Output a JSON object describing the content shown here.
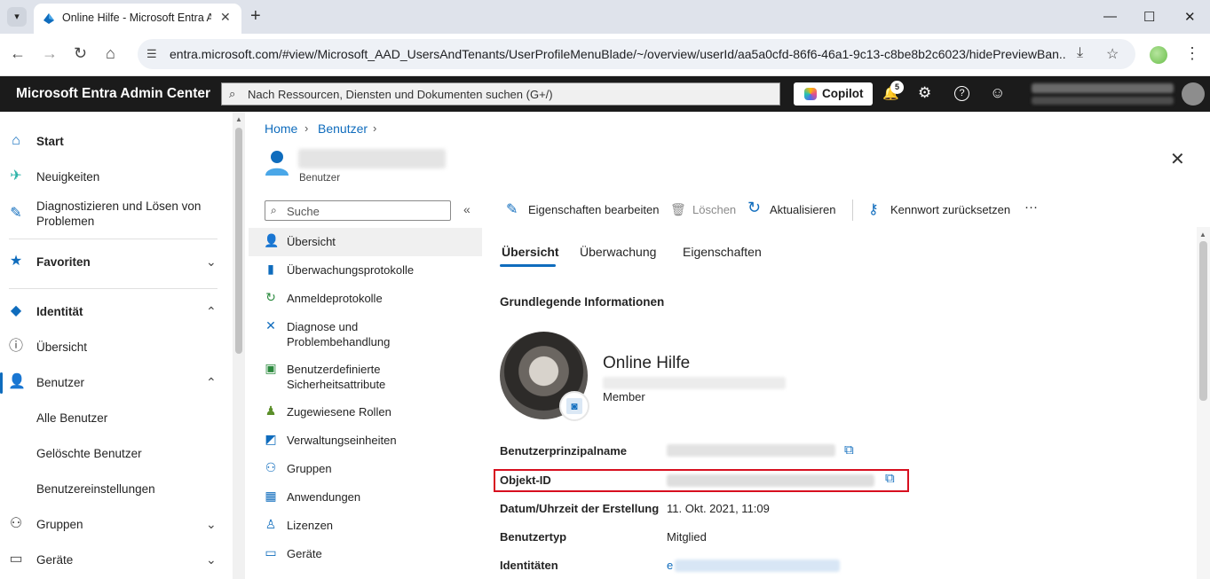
{
  "browser": {
    "tab_title": "Online Hilfe - Microsoft Entra A",
    "url": "entra.microsoft.com/#view/Microsoft_AAD_UsersAndTenants/UserProfileMenuBlade/~/overview/userId/aa5a0cfd-86f6-46a1-9c13-c8be8b2c6023/hidePreviewBan...",
    "icons": {
      "dropdown": "▾",
      "close": "✕",
      "new_tab": "+",
      "minimize": "—",
      "maximize": "☐",
      "win_close": "✕",
      "back": "←",
      "forward": "→",
      "reload": "↻",
      "home": "⌂",
      "site": "☰",
      "install": "⤓",
      "star": "☆",
      "menu": "⋮"
    }
  },
  "header": {
    "brand": "Microsoft Entra Admin Center",
    "search_placeholder": "Nach Ressourcen, Diensten und Dokumenten suchen (G+/)",
    "copilot_label": "Copilot",
    "notification_count": "5",
    "icons": {
      "search": "⌕",
      "bell": "🔔",
      "settings": "⚙",
      "help": "?",
      "feedback": "☺"
    }
  },
  "leftnav": {
    "items": [
      {
        "label": "Start",
        "icon": "⌂",
        "bold": true
      },
      {
        "label": "Neuigkeiten",
        "icon": "✈"
      },
      {
        "label": "Diagnostizieren und Lösen von Problemen",
        "icon": "✎"
      },
      {
        "label": "Favoriten",
        "icon": "★",
        "bold": true,
        "chevron": "⌄"
      },
      {
        "label": "Identität",
        "icon": "◆",
        "bold": true,
        "chevron": "⌃"
      },
      {
        "label": "Übersicht",
        "icon": "ⓘ"
      },
      {
        "label": "Benutzer",
        "icon": "👤",
        "chevron": "⌃"
      },
      {
        "label": "Alle Benutzer"
      },
      {
        "label": "Gelöschte Benutzer"
      },
      {
        "label": "Benutzereinstellungen"
      },
      {
        "label": "Gruppen",
        "icon": "⚇",
        "chevron": "⌄"
      },
      {
        "label": "Geräte",
        "icon": "▭",
        "chevron": "⌄"
      }
    ]
  },
  "breadcrumb": {
    "home": "Home",
    "users": "Benutzer",
    "sep": "›"
  },
  "page": {
    "subtitle": "Benutzer",
    "close": "✕"
  },
  "resource_menu": {
    "search_placeholder": "Suche",
    "collapse": "«",
    "items": [
      {
        "label": "Übersicht",
        "icon": "👤",
        "color": "#0f6cbd"
      },
      {
        "label": "Überwachungsprotokolle",
        "icon": "▮",
        "color": "#0f6cbd"
      },
      {
        "label": "Anmeldeprotokolle",
        "icon": "↻",
        "color": "#2b8a3e"
      },
      {
        "label": "Diagnose und Problembehandlung",
        "icon": "✕",
        "color": "#0f6cbd"
      },
      {
        "label": "Benutzerdefinierte Sicherheitsattribute",
        "icon": "▣",
        "color": "#2b8a3e"
      },
      {
        "label": "Zugewiesene Rollen",
        "icon": "♟",
        "color": "#5b8f2a"
      },
      {
        "label": "Verwaltungseinheiten",
        "icon": "◩",
        "color": "#0f6cbd"
      },
      {
        "label": "Gruppen",
        "icon": "⚇",
        "color": "#0f6cbd"
      },
      {
        "label": "Anwendungen",
        "icon": "▦",
        "color": "#0f6cbd"
      },
      {
        "label": "Lizenzen",
        "icon": "♙",
        "color": "#0f6cbd"
      },
      {
        "label": "Geräte",
        "icon": "▭",
        "color": "#0f6cbd"
      }
    ]
  },
  "commands": {
    "edit": "Eigenschaften bearbeiten",
    "delete": "Löschen",
    "refresh": "Aktualisieren",
    "reset_password": "Kennwort zurücksetzen",
    "more": "···",
    "icons": {
      "edit": "✎",
      "delete": "🗑",
      "refresh": "↻",
      "reset": "⚷"
    }
  },
  "tabs": [
    "Übersicht",
    "Überwachung",
    "Eigenschaften"
  ],
  "overview": {
    "section_title": "Grundlegende Informationen",
    "display_name": "Online Hilfe",
    "user_type_label": "Member",
    "camera_icon": "◙",
    "properties": [
      {
        "label": "Benutzerprinzipalname"
      },
      {
        "label": "Objekt-ID"
      },
      {
        "label": "Datum/Uhrzeit der Erstellung",
        "value": "11. Okt. 2021, 11:09"
      },
      {
        "label": "Benutzertyp",
        "value": "Mitglied"
      },
      {
        "label": "Identitäten",
        "value": "e"
      }
    ],
    "copy_icon": "⧉"
  },
  "colors": {
    "accent": "#0f6cbd",
    "header_bg": "#1b1b1b",
    "highlight": "#d70f1f"
  }
}
